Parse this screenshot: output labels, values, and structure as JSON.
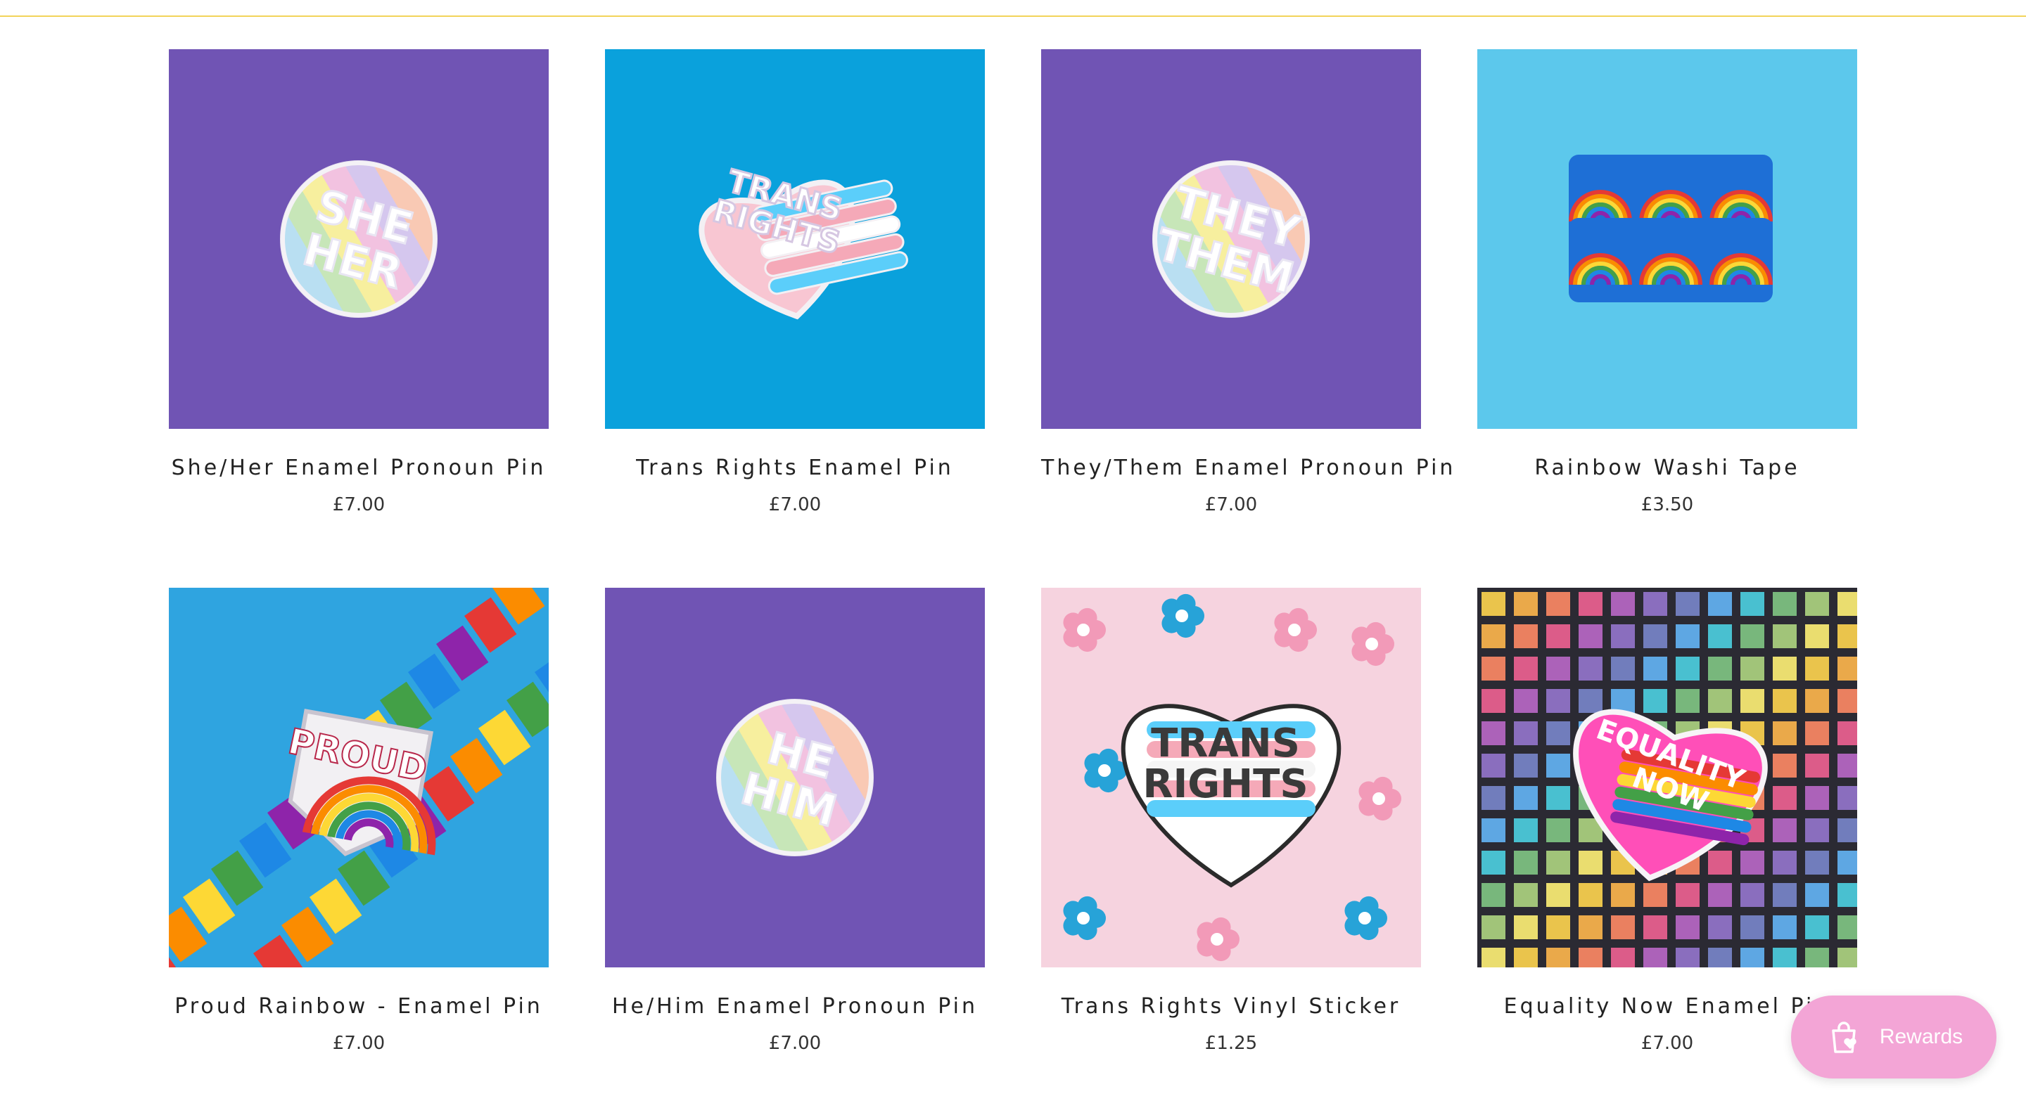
{
  "products": [
    {
      "title": "She/Her Enamel Pronoun Pin",
      "price": "£7.00",
      "bg": "#7054b4",
      "art": "round-pin",
      "pin_text": [
        "SHE",
        "HER"
      ]
    },
    {
      "title": "Trans Rights Enamel Pin",
      "price": "£7.00",
      "bg": "#0aa1dc",
      "art": "heart-pin",
      "pin_text": [
        "TRANS",
        "RIGHTS"
      ]
    },
    {
      "title": "They/Them Enamel Pronoun Pin",
      "price": "£7.00",
      "bg": "#7054b4",
      "art": "round-pin",
      "pin_text": [
        "THEY",
        "THEM"
      ]
    },
    {
      "title": "Rainbow Washi Tape",
      "price": "£3.50",
      "bg": "#5cc8ec",
      "art": "washi-tape",
      "pin_text": []
    },
    {
      "title": "Proud Rainbow - Enamel Pin",
      "price": "£7.00",
      "bg": "#2fa4e0",
      "art": "shield-pin",
      "pin_text": [
        "PROUD"
      ]
    },
    {
      "title": "He/Him Enamel Pronoun Pin",
      "price": "£7.00",
      "bg": "#7054b4",
      "art": "round-pin",
      "pin_text": [
        "HE",
        "HIM"
      ]
    },
    {
      "title": "Trans Rights Vinyl Sticker",
      "price": "£1.25",
      "bg": "#f6d3df",
      "art": "heart-sticker",
      "pin_text": [
        "TRANS",
        "RIGHTS"
      ]
    },
    {
      "title": "Equality Now Enamel Pin",
      "price": "£7.00",
      "bg": "#2b2a33",
      "art": "equality-pin",
      "pin_text": [
        "EQUALITY",
        "NOW"
      ]
    }
  ],
  "rewards": {
    "label": "Rewards",
    "icon": "shopping-bag-heart-icon"
  },
  "colors": {
    "accent_rule": "#f2d35a",
    "rewards_bg": "#f3a5d6",
    "pastel": [
      "#b9dff2",
      "#c7e6b8",
      "#f7ef9e",
      "#f2c2e0",
      "#d5c7ee",
      "#f9c9b4"
    ],
    "trans": [
      "#5bcefa",
      "#f5a9b8",
      "#ffffff"
    ],
    "rainbow": [
      "#e53935",
      "#fb8c00",
      "#fdd835",
      "#43a047",
      "#1e88e5",
      "#8e24aa"
    ]
  }
}
